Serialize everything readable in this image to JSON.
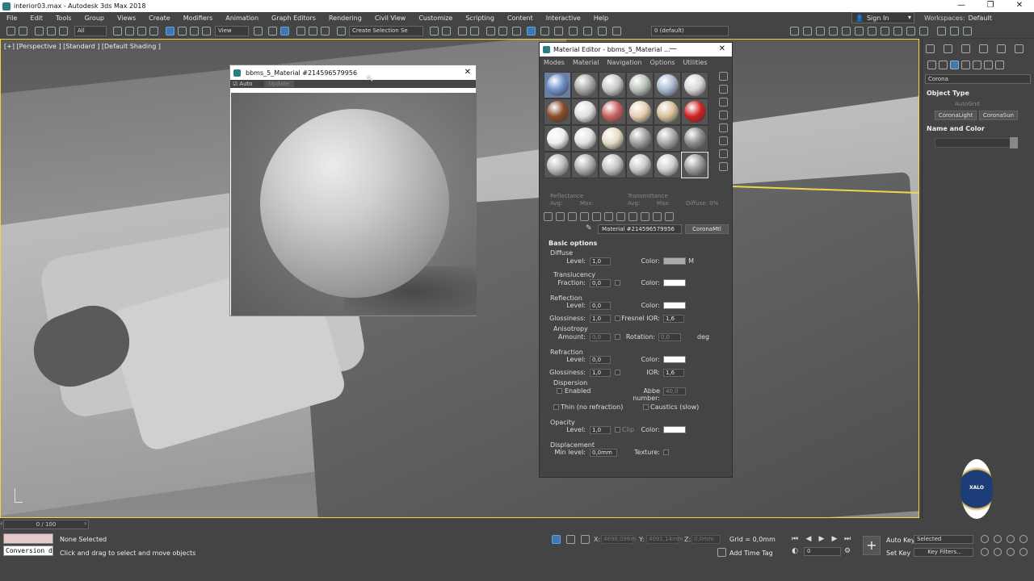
{
  "window": {
    "title": "interior03.max - Autodesk 3ds Max 2018",
    "minimize": "—",
    "restore": "❐",
    "close": "✕"
  },
  "menu": [
    "File",
    "Edit",
    "Tools",
    "Group",
    "Views",
    "Create",
    "Modifiers",
    "Animation",
    "Graph Editors",
    "Rendering",
    "Civil View",
    "Customize",
    "Scripting",
    "Content",
    "Interactive",
    "Help"
  ],
  "account": {
    "signin": "Sign In",
    "workspace_label": "Workspaces:",
    "workspace_value": "Default"
  },
  "toolbar": {
    "filter": "All",
    "refcoord": "View",
    "selection_set": "Create Selection Se",
    "layer": "0 (default)"
  },
  "viewport": {
    "label": "[+] [Perspective ] [Standard ] [Default Shading ]"
  },
  "preview": {
    "title": "bbms_5_Material #214596579956",
    "auto": "Auto",
    "update": "Update"
  },
  "material_editor": {
    "title": "Material Editor - bbms_5_Material ...",
    "menu": [
      "Modes",
      "Material",
      "Navigation",
      "Options",
      "Utilities"
    ],
    "slot_colors": [
      "#6f8fc8",
      "#a8a8a8",
      "#c9c9c9",
      "#b9c2b9",
      "#a9b8d2",
      "#d6d6d6",
      "#8a4a2a",
      "#e0e0e0",
      "#c96060",
      "#e6cdb0",
      "#d8c09a",
      "#d02020",
      "#eeeeee",
      "#e2e2e2",
      "#e8dcc4",
      "#a0a0a0",
      "#a8a8a8",
      "#8c8c8c",
      "#bcbcbc",
      "#b0b0b0",
      "#c4c4c4",
      "#c8c8c8",
      "#cfcfcf",
      "#9a9a9a"
    ],
    "stats": {
      "reflectance": "Reflectance",
      "transmittance": "Transmittance",
      "avg": "Avg:",
      "max": "Max:",
      "diffuse": "Diffuse: 0%"
    },
    "material_name": "Material #214596579956",
    "material_type": "CoronaMtl",
    "basic_options": "Basic options",
    "diffuse": {
      "section": "Diffuse",
      "level_label": "Level:",
      "level": "1,0",
      "color_label": "Color:",
      "map_m": "M",
      "translucency": "Translucency",
      "fraction_label": "Fraction:",
      "fraction": "0,0",
      "color2_label": "Color:"
    },
    "reflection": {
      "section": "Reflection",
      "level_label": "Level:",
      "level": "0,0",
      "color_label": "Color:",
      "gloss_label": "Glossiness:",
      "gloss": "1,0",
      "fresnel_label": "Fresnel IOR:",
      "fresnel": "1,6",
      "anisotropy": "Anisotropy",
      "amount_label": "Amount:",
      "amount": "0,0",
      "rotation_label": "Rotation:",
      "rotation": "0,0",
      "deg": "deg"
    },
    "refraction": {
      "section": "Refraction",
      "level_label": "Level:",
      "level": "0,0",
      "color_label": "Color:",
      "gloss_label": "Glossiness:",
      "gloss": "1,0",
      "ior_label": "IOR:",
      "ior": "1,6",
      "dispersion": "Dispersion",
      "enabled": "Enabled",
      "abbe_label": "Abbe number:",
      "abbe": "40,0",
      "thin": "Thin (no refraction)",
      "caustics": "Caustics (slow)"
    },
    "opacity": {
      "section": "Opacity",
      "level_label": "Level:",
      "level": "1,0",
      "clip": "Clip",
      "color_label": "Color:"
    },
    "displacement": {
      "section": "Displacement",
      "min_label": "Min level:",
      "min": "0,0mm",
      "texture_label": "Texture:"
    }
  },
  "command_panel": {
    "category": "Corona",
    "object_type": "Object Type",
    "autogrid": "AutoGrid",
    "btn_light": "CoronaLight",
    "btn_sun": "CoronaSun",
    "name_color": "Name and Color"
  },
  "logo_text": "XALO",
  "timeline": {
    "frame": "0 / 100"
  },
  "status": {
    "maxscript_line2": "Conversion di",
    "selection": "None Selected",
    "prompt": "Click and drag to select and move objects",
    "x_label": "X:",
    "x": "4696,096m",
    "y_label": "Y:",
    "y": "4091,14mm",
    "z_label": "Z:",
    "z": "0,0mm",
    "grid": "Grid = 0,0mm",
    "add_time_tag": "Add Time Tag",
    "auto_key": "Auto Key",
    "selected": "Selected",
    "set_key": "Set Key",
    "key_filters": "Key Filters...",
    "current_frame": "0"
  }
}
